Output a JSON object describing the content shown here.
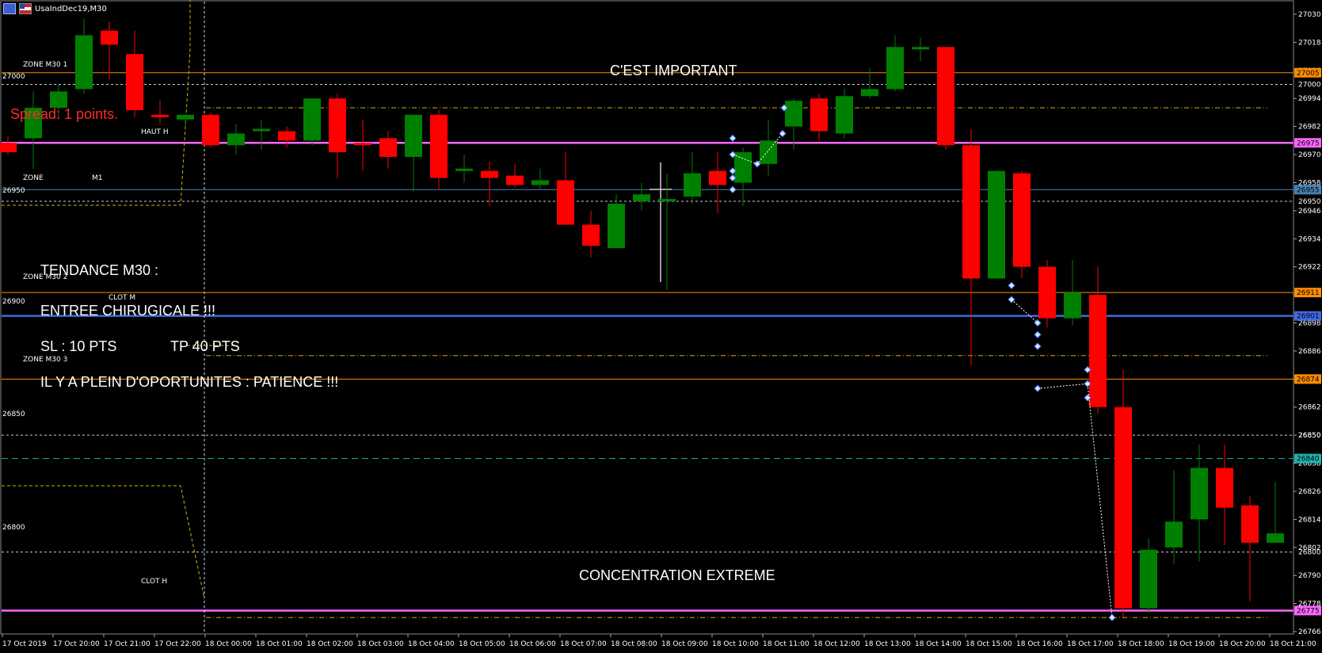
{
  "header": {
    "symbol_title": "UsaIndDec19,M30",
    "icon_left": "chart-window-icon",
    "icon_right": "us-flag-icon"
  },
  "spread_text": "Spread: 1 points.",
  "colors": {
    "background": "#000000",
    "bull": "#008000",
    "bear": "#ff0000",
    "wick": "#ffffff",
    "orange_line": "#ff8c00",
    "magenta_line": "#ff66ff",
    "blue_line": "#4169e1",
    "steelblue_line": "#4682b4",
    "yellow_dash": "#d4b000",
    "cyan_dash": "#20b2aa",
    "white_dotted": "#cccccc"
  },
  "zone_labels": [
    {
      "text": "ZONE M30 1"
    },
    {
      "text": "27000"
    },
    {
      "text": "HAUT H"
    },
    {
      "text": "ZONE"
    },
    {
      "text": "M1"
    },
    {
      "text": "26950"
    },
    {
      "text": "ZONE M30 2"
    },
    {
      "text": "26900"
    },
    {
      "text": "CLOT M"
    },
    {
      "text": "ZONE M30 3"
    },
    {
      "text": "26850"
    },
    {
      "text": "26800"
    },
    {
      "text": "CLOT H"
    }
  ],
  "annotations": [
    {
      "text": "C'EST IMPORTANT"
    },
    {
      "text": "TENDANCE M30 :"
    },
    {
      "text": "ENTREE CHIRUGICALE !!!"
    },
    {
      "text": "SL : 10 PTS"
    },
    {
      "text": "TP 40 PTS"
    },
    {
      "text": "IL Y A PLEIN D'OPORTUNITES : PATIENCE !!!"
    },
    {
      "text": "CONCENTRATION EXTREME"
    }
  ],
  "chart_data": {
    "type": "candlestick",
    "title": "UsaIndDec19,M30",
    "ylim": [
      26770,
      27031
    ],
    "y_ticks": [
      "27030",
      "27018",
      "27006",
      "26994",
      "26982",
      "26970",
      "26958",
      "26946",
      "26934",
      "26922",
      "26910",
      "26898",
      "26886",
      "26874",
      "26862",
      "26850",
      "26838",
      "26826",
      "26814",
      "26802",
      "26790",
      "26778",
      "26766"
    ],
    "x_ticks": [
      "17 Oct 2019",
      "17 Oct 20:00",
      "17 Oct 21:00",
      "17 Oct 22:00",
      "18 Oct 00:00",
      "18 Oct 01:00",
      "18 Oct 02:00",
      "18 Oct 03:00",
      "18 Oct 04:00",
      "18 Oct 05:00",
      "18 Oct 06:00",
      "18 Oct 07:00",
      "18 Oct 08:00",
      "18 Oct 09:00",
      "18 Oct 10:00",
      "18 Oct 11:00",
      "18 Oct 12:00",
      "18 Oct 13:00",
      "18 Oct 14:00",
      "18 Oct 15:00",
      "18 Oct 16:00",
      "18 Oct 17:00",
      "18 Oct 18:00",
      "18 Oct 19:00",
      "18 Oct 20:00",
      "18 Oct 21:00"
    ],
    "price_tags": [
      {
        "price": 27005,
        "label": "27005",
        "color": "#ff8c00"
      },
      {
        "price": 26975,
        "label": "26975",
        "color": "#ff66ff"
      },
      {
        "price": 26955,
        "label": "26955",
        "color": "#4682b4"
      },
      {
        "price": 26911,
        "label": "26911",
        "color": "#ff8c00"
      },
      {
        "price": 26901,
        "label": "26901",
        "color": "#4169e1"
      },
      {
        "price": 26874,
        "label": "26874",
        "color": "#ff8c00"
      },
      {
        "price": 26840,
        "label": "26840",
        "color": "#20b2aa"
      },
      {
        "price": 26775,
        "label": "26775",
        "color": "#ff66ff"
      }
    ],
    "plain_tags": [
      {
        "price": 27000,
        "label": "27000"
      },
      {
        "price": 26950,
        "label": "26950"
      },
      {
        "price": 26850,
        "label": "26850"
      },
      {
        "price": 26800,
        "label": "26800"
      }
    ],
    "candles": [
      {
        "o": 26975,
        "h": 26978,
        "l": 26970,
        "c": 26971
      },
      {
        "o": 26977,
        "h": 26997,
        "l": 26964,
        "c": 26990
      },
      {
        "o": 26990,
        "h": 27000,
        "l": 26985,
        "c": 26997
      },
      {
        "o": 26998,
        "h": 27028,
        "l": 26996,
        "c": 27021
      },
      {
        "o": 27023,
        "h": 27027,
        "l": 27002,
        "c": 27017
      },
      {
        "o": 27013,
        "h": 27023,
        "l": 26986,
        "c": 26989
      },
      {
        "o": 26987,
        "h": 26993,
        "l": 26983,
        "c": 26986
      },
      {
        "o": 26985,
        "h": 26985,
        "l": 26982,
        "c": 26987
      },
      {
        "o": 26987,
        "h": 26988,
        "l": 26973,
        "c": 26974
      },
      {
        "o": 26974,
        "h": 26983,
        "l": 26970,
        "c": 26979
      },
      {
        "o": 26980,
        "h": 26985,
        "l": 26972,
        "c": 26981
      },
      {
        "o": 26980,
        "h": 26982,
        "l": 26973,
        "c": 26976
      },
      {
        "o": 26976,
        "h": 26993,
        "l": 26974,
        "c": 26994
      },
      {
        "o": 26994,
        "h": 26996,
        "l": 26960,
        "c": 26971
      },
      {
        "o": 26975,
        "h": 26985,
        "l": 26963,
        "c": 26974
      },
      {
        "o": 26977,
        "h": 26980,
        "l": 26964,
        "c": 26969
      },
      {
        "o": 26969,
        "h": 26984,
        "l": 26954,
        "c": 26987
      },
      {
        "o": 26987,
        "h": 26989,
        "l": 26955,
        "c": 26960
      },
      {
        "o": 26963,
        "h": 26970,
        "l": 26958,
        "c": 26964
      },
      {
        "o": 26963,
        "h": 26967,
        "l": 26948,
        "c": 26960
      },
      {
        "o": 26961,
        "h": 26966,
        "l": 26956,
        "c": 26957
      },
      {
        "o": 26957,
        "h": 26964,
        "l": 26955,
        "c": 26959
      },
      {
        "o": 26959,
        "h": 26971,
        "l": 26943,
        "c": 26940
      },
      {
        "o": 26940,
        "h": 26946,
        "l": 26926,
        "c": 26931
      },
      {
        "o": 26930,
        "h": 26953,
        "l": 26930,
        "c": 26949
      },
      {
        "o": 26950,
        "h": 26958,
        "l": 26946,
        "c": 26953
      },
      {
        "o": 26950,
        "h": 26962,
        "l": 26912,
        "c": 26951
      },
      {
        "o": 26952,
        "h": 26971,
        "l": 26949,
        "c": 26962
      },
      {
        "o": 26963,
        "h": 26971,
        "l": 26945,
        "c": 26957
      },
      {
        "o": 26958,
        "h": 26973,
        "l": 26948,
        "c": 26971
      },
      {
        "o": 26966,
        "h": 26985,
        "l": 26961,
        "c": 26976
      },
      {
        "o": 26982,
        "h": 26994,
        "l": 26972,
        "c": 26993
      },
      {
        "o": 26994,
        "h": 26996,
        "l": 26976,
        "c": 26980
      },
      {
        "o": 26979,
        "h": 26998,
        "l": 26977,
        "c": 26995
      },
      {
        "o": 26995,
        "h": 27007,
        "l": 26994,
        "c": 26998
      },
      {
        "o": 26998,
        "h": 27021,
        "l": 26997,
        "c": 27016
      },
      {
        "o": 27015,
        "h": 27020,
        "l": 27010,
        "c": 27016
      },
      {
        "o": 27016,
        "h": 27016,
        "l": 26972,
        "c": 26974
      },
      {
        "o": 26974,
        "h": 26981,
        "l": 26880,
        "c": 26917
      },
      {
        "o": 26917,
        "h": 26963,
        "l": 26917,
        "c": 26963
      },
      {
        "o": 26962,
        "h": 26963,
        "l": 26917,
        "c": 26922
      },
      {
        "o": 26922,
        "h": 26925,
        "l": 26896,
        "c": 26900
      },
      {
        "o": 26900,
        "h": 26925,
        "l": 26897,
        "c": 26911
      },
      {
        "o": 26910,
        "h": 26922,
        "l": 26859,
        "c": 26862
      },
      {
        "o": 26862,
        "h": 26878,
        "l": 26772,
        "c": 26776
      },
      {
        "o": 26776,
        "h": 26806,
        "l": 26774,
        "c": 26801
      },
      {
        "o": 26802,
        "h": 26835,
        "l": 26795,
        "c": 26813
      },
      {
        "o": 26814,
        "h": 26846,
        "l": 26796,
        "c": 26836
      },
      {
        "o": 26836,
        "h": 26846,
        "l": 26803,
        "c": 26819
      },
      {
        "o": 26820,
        "h": 26824,
        "l": 26779,
        "c": 26804
      },
      {
        "o": 26804,
        "h": 26830,
        "l": 26804,
        "c": 26808
      }
    ]
  }
}
